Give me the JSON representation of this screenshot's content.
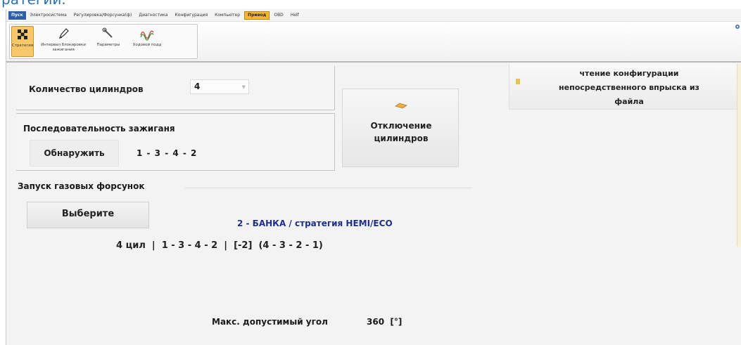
{
  "top_text": "ратегии.",
  "menu": {
    "items": [
      "Пуск",
      "Электросистема",
      "Регулировка/Форсунка(ф)",
      "Диагностика",
      "Конфигурация",
      "Компьютер",
      "Привод",
      "OBD",
      "Helf"
    ],
    "active_index": 6
  },
  "ribbon": {
    "buttons": [
      {
        "label": "Стратегия",
        "icon": "strategy-icon"
      },
      {
        "label": "Интервал блокировки\nзажигания",
        "icon": "pen-icon"
      },
      {
        "label": "Параметры",
        "icon": "wrench-icon"
      },
      {
        "label": "Ходовой подд",
        "icon": "wave-icon"
      }
    ],
    "selected_index": 0
  },
  "cylinders": {
    "label": "Количество цилиндров",
    "value": "4"
  },
  "firing": {
    "title": "Последовательность зажиганя",
    "detect_button": "Обнаружить",
    "order": "1 - 3 - 4 - 2"
  },
  "disable_button": {
    "label_line1": "Отключение",
    "label_line2": "цилиндров"
  },
  "read_button": {
    "line1": "чтение конфигурации",
    "line2": "непосредственного впрыска из",
    "line3": "файла"
  },
  "gas_injectors": {
    "title": "Запуск газовых форсунок",
    "select_button": "Выберите",
    "strategy": "2 - БАНКА / стратегия HEMI/ECO",
    "sequence": "4 цил  |  1 - 3 - 4 - 2  |  [-2]  (4 - 3 - 2 - 1)"
  },
  "max_angle": {
    "label": "Макс. допустимый угол",
    "value": "360  [°]"
  },
  "colors": {
    "accent_blue": "#1f2f8c",
    "file_menu": "#2d5fa8",
    "active_menu": "#f7b733"
  }
}
